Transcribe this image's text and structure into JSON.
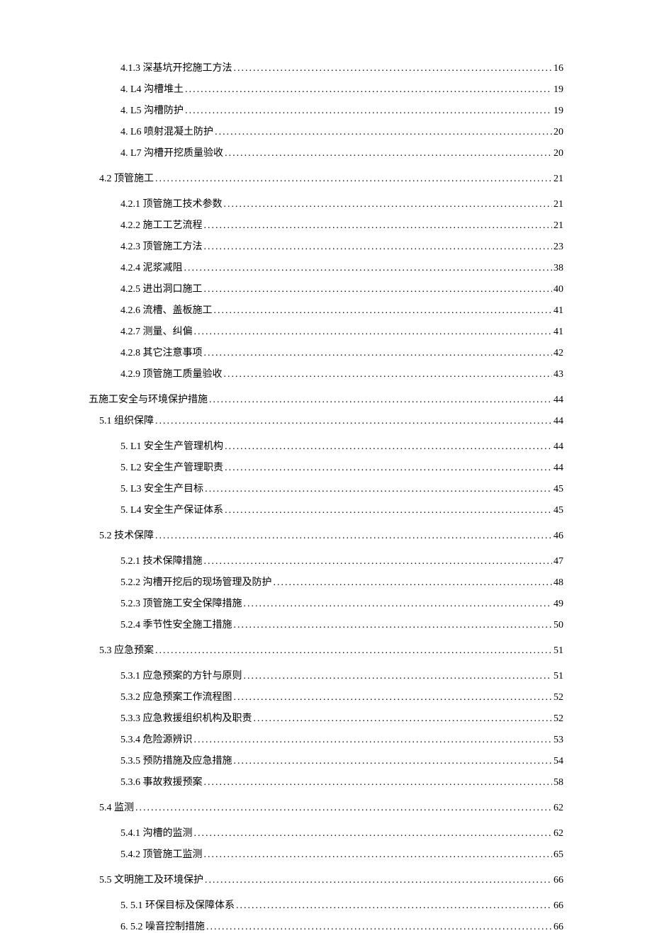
{
  "toc": [
    {
      "label": "4.1.3 深基坑开挖施工方法",
      "page": "16",
      "indent": 2,
      "gap": false
    },
    {
      "label": "4. L4 沟槽堆土",
      "page": "19",
      "indent": 2,
      "gap": false
    },
    {
      "label": "4. L5 沟槽防护",
      "page": "19",
      "indent": 2,
      "gap": false
    },
    {
      "label": "4. L6 喷射混凝土防护",
      "page": "20",
      "indent": 2,
      "gap": false
    },
    {
      "label": "4. L7 沟槽开挖质量验收",
      "page": "20",
      "indent": 2,
      "gap": false
    },
    {
      "label": "4.2 顶管施工",
      "page": "21",
      "indent": 1,
      "gap": true
    },
    {
      "label": "4.2.1 顶管施工技术参数",
      "page": "21",
      "indent": 2,
      "gap": true
    },
    {
      "label": "4.2.2 施工工艺流程",
      "page": "21",
      "indent": 2,
      "gap": false
    },
    {
      "label": "4.2.3 顶管施工方法",
      "page": "23",
      "indent": 2,
      "gap": false
    },
    {
      "label": "4.2.4 泥浆减阻",
      "page": "38",
      "indent": 2,
      "gap": false
    },
    {
      "label": "4.2.5 进出洞口施工",
      "page": "40",
      "indent": 2,
      "gap": false
    },
    {
      "label": "4.2.6 流槽、盖板施工",
      "page": "41",
      "indent": 2,
      "gap": false
    },
    {
      "label": "4.2.7 测量、纠偏",
      "page": "41",
      "indent": 2,
      "gap": false
    },
    {
      "label": "4.2.8 其它注意事项",
      "page": "42",
      "indent": 2,
      "gap": false
    },
    {
      "label": "4.2.9 顶管施工质量验收",
      "page": "43",
      "indent": 2,
      "gap": false
    },
    {
      "label": "五施工安全与环境保护措施",
      "page": "44",
      "indent": 0,
      "gap": true
    },
    {
      "label": "5.1 组织保障",
      "page": "44",
      "indent": 1,
      "gap": false
    },
    {
      "label": "5. L1 安全生产管理机构",
      "page": "44",
      "indent": 2,
      "gap": true
    },
    {
      "label": "5. L2 安全生产管理职责",
      "page": "44",
      "indent": 2,
      "gap": false
    },
    {
      "label": "5. L3 安全生产目标",
      "page": "45",
      "indent": 2,
      "gap": false
    },
    {
      "label": "5. L4 安全生产保证体系",
      "page": "45",
      "indent": 2,
      "gap": false
    },
    {
      "label": "5.2 技术保障",
      "page": "46",
      "indent": 1,
      "gap": true
    },
    {
      "label": "5.2.1 技术保障措施",
      "page": "47",
      "indent": 2,
      "gap": true
    },
    {
      "label": "5.2.2 沟槽开挖后的现场管理及防护",
      "page": "48",
      "indent": 2,
      "gap": false
    },
    {
      "label": "5.2.3 顶管施工安全保障措施",
      "page": "49",
      "indent": 2,
      "gap": false
    },
    {
      "label": "5.2.4 季节性安全施工措施",
      "page": "50",
      "indent": 2,
      "gap": false
    },
    {
      "label": "5.3 应急预案",
      "page": "51",
      "indent": 1,
      "gap": true
    },
    {
      "label": "5.3.1 应急预案的方针与原则",
      "page": "51",
      "indent": 2,
      "gap": true
    },
    {
      "label": "5.3.2 应急预案工作流程图",
      "page": "52",
      "indent": 2,
      "gap": false
    },
    {
      "label": "5.3.3 应急救援组织机构及职责",
      "page": "52",
      "indent": 2,
      "gap": false
    },
    {
      "label": "5.3.4 危险源辨识",
      "page": "53",
      "indent": 2,
      "gap": false
    },
    {
      "label": "5.3.5 预防措施及应急措施",
      "page": "54",
      "indent": 2,
      "gap": false
    },
    {
      "label": "5.3.6 事故救援预案",
      "page": "58",
      "indent": 2,
      "gap": false
    },
    {
      "label": "5.4 监测",
      "page": "62",
      "indent": 1,
      "gap": true
    },
    {
      "label": "5.4.1 沟槽的监测",
      "page": "62",
      "indent": 2,
      "gap": true
    },
    {
      "label": "5.4.2 顶管施工监测",
      "page": "65",
      "indent": 2,
      "gap": false
    },
    {
      "label": "5.5 文明施工及环境保护",
      "page": "66",
      "indent": 1,
      "gap": true
    },
    {
      "label": "5.  5.1 环保目标及保障体系",
      "page": "66",
      "indent": 2,
      "gap": true
    },
    {
      "label": "6.  5.2 噪音控制措施",
      "page": "66",
      "indent": 2,
      "gap": false
    }
  ]
}
